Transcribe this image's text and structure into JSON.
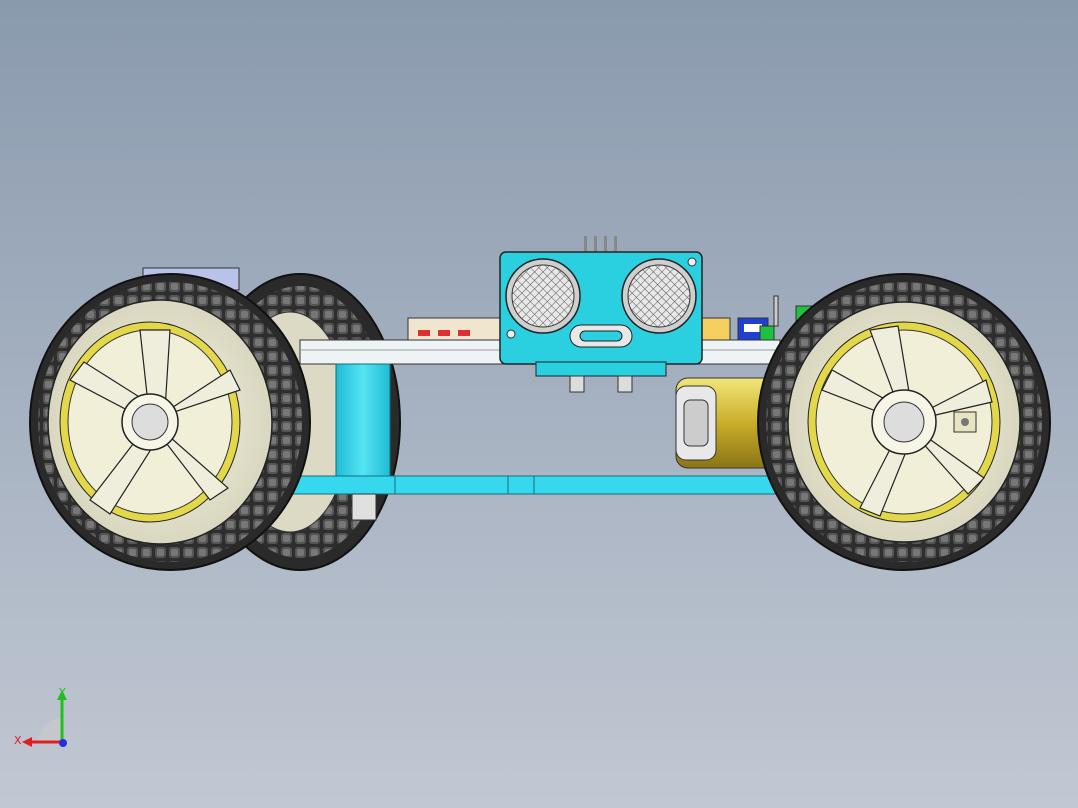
{
  "viewport": {
    "background_top": "#8a9aae",
    "background_bottom": "#c2c8d3"
  },
  "model": {
    "parts": [
      "ultrasonic-sensor",
      "chassis-top-plate",
      "chassis-bottom-plate",
      "standoff",
      "front-wheel",
      "rear-wheel",
      "rear-wheel-back",
      "gear-motor",
      "control-board"
    ],
    "colors": {
      "chassis": "#35d8ec",
      "tire": "#3a3a3a",
      "rim": "#ecebd6",
      "hub_yellow": "#e2d84a",
      "motor_yellow": "#d8c23c",
      "sensor_board": "#2ad0e0",
      "transducer": "#dcdcdc"
    }
  },
  "triad": {
    "x_label": "X",
    "y_label": "Y",
    "x_color": "#e02020",
    "y_color": "#20c020",
    "z_color": "#2030e0"
  }
}
